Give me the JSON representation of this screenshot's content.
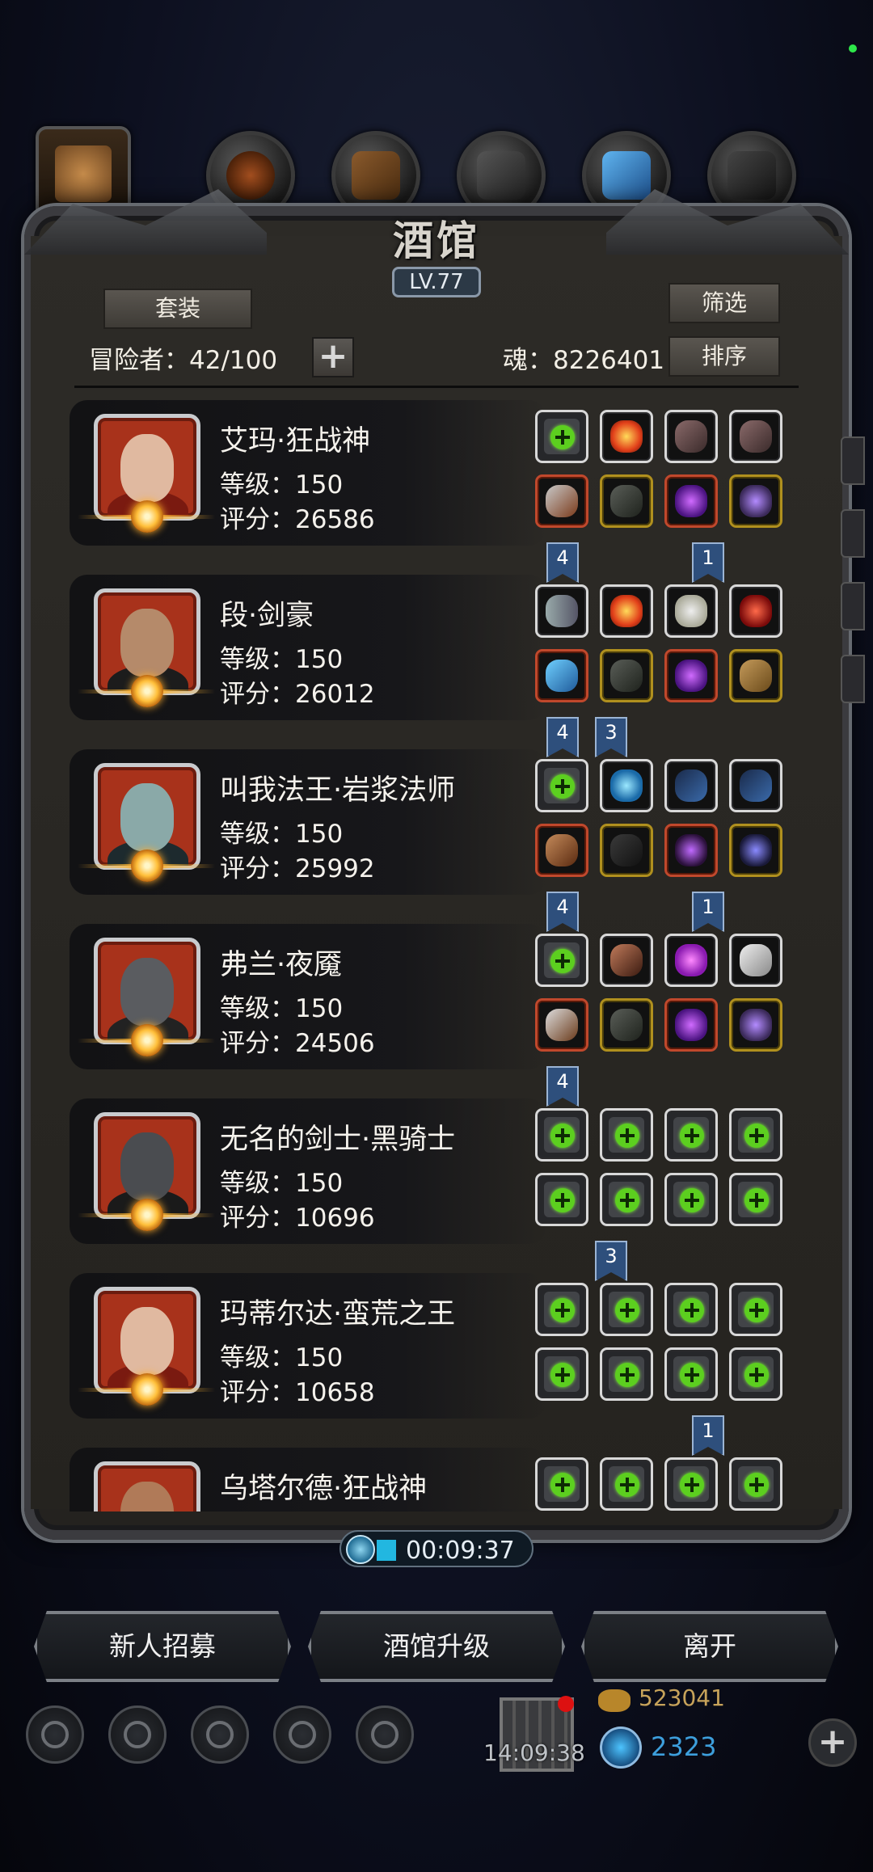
{
  "header": {
    "title": "酒馆",
    "level": "LV.77",
    "suit_label": "套装",
    "filter_label": "筛选",
    "sort_label": "排序",
    "adventurer_count": "冒险者：42/100",
    "add_label": "+",
    "soul": "魂：8226401"
  },
  "category_tabs": [
    "portrait-tab",
    "shield-tab",
    "weapon-tab",
    "armor-tab",
    "crystal-tab",
    "gear-tab"
  ],
  "heroes": [
    {
      "name": "艾玛·狂战神",
      "level": "等级：150",
      "score": "评分：26586",
      "portrait": "red-haired-woman",
      "slots": [
        [
          "plus",
          "white"
        ],
        [
          "item-fire",
          "white"
        ],
        [
          "item-feather",
          "white"
        ],
        [
          "item-feather",
          "white"
        ],
        [
          "item-axe",
          "red"
        ],
        [
          "item-armor",
          "gold"
        ],
        [
          "item-orb",
          "red"
        ],
        [
          "item-ring",
          "gold"
        ]
      ]
    },
    {
      "name": "段·剑豪",
      "level": "等级：150",
      "score": "评分：26012",
      "portrait": "hat-swordsman",
      "slots": [
        [
          "item-chain",
          "white"
        ],
        [
          "item-fire",
          "white"
        ],
        [
          "item-skull",
          "white"
        ],
        [
          "item-gem-red",
          "white"
        ],
        [
          "item-sword",
          "red"
        ],
        [
          "item-armor",
          "gold"
        ],
        [
          "item-orb",
          "red"
        ],
        [
          "item-scroll",
          "gold"
        ]
      ]
    },
    {
      "name": "叫我法王·岩浆法师",
      "level": "等级：150",
      "score": "评分：25992",
      "portrait": "hooded-mage",
      "slots": [
        [
          "plus",
          "white"
        ],
        [
          "item-blue-orb",
          "white"
        ],
        [
          "item-whip",
          "white"
        ],
        [
          "item-whip",
          "white"
        ],
        [
          "item-staff",
          "red"
        ],
        [
          "item-robe",
          "gold"
        ],
        [
          "item-amulet",
          "red"
        ],
        [
          "item-pentagram",
          "gold"
        ]
      ]
    },
    {
      "name": "弗兰·夜魇",
      "level": "等级：150",
      "score": "评分：24506",
      "portrait": "helmet-knight",
      "slots": [
        [
          "plus",
          "white"
        ],
        [
          "item-ore",
          "white"
        ],
        [
          "item-purple-gem",
          "white"
        ],
        [
          "item-horn",
          "white"
        ],
        [
          "item-dagger",
          "red"
        ],
        [
          "item-armor",
          "gold"
        ],
        [
          "item-orb",
          "red"
        ],
        [
          "item-ring",
          "gold"
        ]
      ]
    },
    {
      "name": "无名的剑士·黑骑士",
      "level": "等级：150",
      "score": "评分：10696",
      "portrait": "black-knight",
      "slots": [
        [
          "plus",
          "white"
        ],
        [
          "plus",
          "white"
        ],
        [
          "plus",
          "white"
        ],
        [
          "plus",
          "white"
        ],
        [
          "plus",
          "white"
        ],
        [
          "plus",
          "white"
        ],
        [
          "plus",
          "white"
        ],
        [
          "plus",
          "white"
        ]
      ]
    },
    {
      "name": "玛蒂尔达·蛮荒之王",
      "level": "等级：150",
      "score": "评分：10658",
      "portrait": "red-haired-woman",
      "slots": [
        [
          "plus",
          "white"
        ],
        [
          "plus",
          "white"
        ],
        [
          "plus",
          "white"
        ],
        [
          "plus",
          "white"
        ],
        [
          "plus",
          "white"
        ],
        [
          "plus",
          "white"
        ],
        [
          "plus",
          "white"
        ],
        [
          "plus",
          "white"
        ]
      ]
    },
    {
      "name": "乌塔尔德·狂战神",
      "level": "",
      "score": "",
      "portrait": "bald-warrior",
      "slots": [
        [
          "plus",
          "white"
        ],
        [
          "plus",
          "white"
        ],
        [
          "plus",
          "white"
        ],
        [
          "plus",
          "white"
        ]
      ]
    }
  ],
  "set_flags": [
    [
      {
        "text": "4",
        "col": 1
      },
      {
        "text": "1",
        "col": 3
      }
    ],
    [
      {
        "text": "4",
        "col": 1
      },
      {
        "text": "3",
        "col": 2
      }
    ],
    [
      {
        "text": "4",
        "col": 1
      },
      {
        "text": "1",
        "col": 3
      }
    ],
    [
      {
        "text": "4",
        "col": 1
      }
    ],
    [
      {
        "text": "3",
        "col": 2
      }
    ],
    [
      {
        "text": "1",
        "col": 3
      }
    ]
  ],
  "timer": "00:09:37",
  "actions": {
    "recruit": "新人招募",
    "upgrade": "酒馆升级",
    "leave": "离开"
  },
  "bottom_bar": {
    "clock": "14:09:38",
    "gold": "523041",
    "gems": "2323",
    "add_label": "+"
  },
  "colors": {
    "accent_green": "#5ccf1f",
    "flag_blue": "#2e4f7c",
    "gem_blue": "#3d9fdc"
  }
}
